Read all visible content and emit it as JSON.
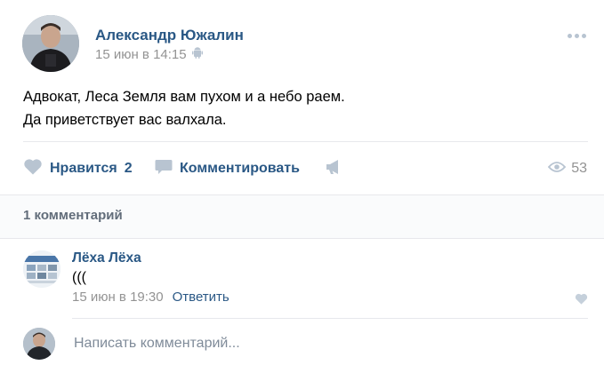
{
  "post": {
    "author": "Александр Южалин",
    "date": "15 июн в 14:15",
    "text_lines": [
      "Адвокат, Леса Земля вам пухом и а небо раем.",
      "Да приветствует вас валхала."
    ]
  },
  "actions": {
    "like_label": "Нравится",
    "like_count": "2",
    "comment_label": "Комментировать",
    "views_count": "53"
  },
  "comments": {
    "count_label": "1 комментарий",
    "items": [
      {
        "author": "Лёха Лёха",
        "text": "(((",
        "date": "15 июн в 19:30",
        "reply_label": "Ответить"
      }
    ]
  },
  "reply_box": {
    "placeholder": "Написать комментарий..."
  },
  "colors": {
    "link": "#2a5885",
    "meta": "#939393",
    "icon": "#b8c4d1",
    "divider": "#e7e8ec"
  }
}
